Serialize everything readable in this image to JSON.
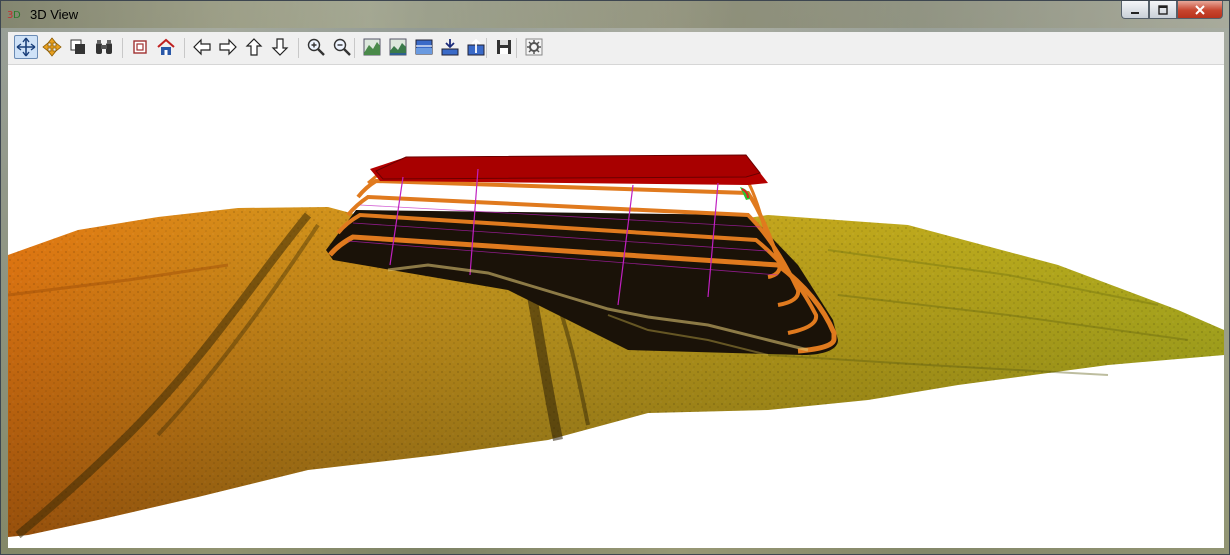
{
  "window": {
    "title": "3D View",
    "icon": "3d-view-app-icon"
  },
  "window_buttons": {
    "minimize": "minimize-icon",
    "maximize": "maximize-icon",
    "close": "close-icon"
  },
  "toolbar": {
    "buttons": [
      {
        "name": "rotate-tool",
        "icon": "rotate-arrows-icon"
      },
      {
        "name": "pan-tool",
        "icon": "pan-move-icon"
      },
      {
        "name": "layers-tool",
        "icon": "layers-icon"
      },
      {
        "name": "binoculars-tool",
        "icon": "binoculars-icon"
      },
      {
        "name": "fit-extent-tool",
        "icon": "fit-extent-icon"
      },
      {
        "name": "home-view-tool",
        "icon": "home-icon"
      },
      {
        "name": "move-left-tool",
        "icon": "arrow-left-icon"
      },
      {
        "name": "move-right-tool",
        "icon": "arrow-right-icon"
      },
      {
        "name": "move-up-tool",
        "icon": "arrow-up-icon"
      },
      {
        "name": "move-down-tool",
        "icon": "arrow-down-icon"
      },
      {
        "name": "zoom-in-tool",
        "icon": "zoom-in-icon"
      },
      {
        "name": "zoom-out-tool",
        "icon": "zoom-out-icon"
      },
      {
        "name": "terrain-tool-1",
        "icon": "terrain-icon"
      },
      {
        "name": "terrain-tool-2",
        "icon": "terrain-icon"
      },
      {
        "name": "water-level-tool",
        "icon": "water-level-icon"
      },
      {
        "name": "lower-level-tool",
        "icon": "lower-level-icon"
      },
      {
        "name": "raise-level-tool",
        "icon": "raise-level-icon"
      },
      {
        "name": "save-tool",
        "icon": "save-icon"
      },
      {
        "name": "settings-tool",
        "icon": "settings-icon"
      }
    ]
  },
  "colors": {
    "surface_high": "#e87a12",
    "surface_mid": "#c9a020",
    "surface_low": "#b9b820",
    "structure_top": "#b30000",
    "structure_band": "#1a1208",
    "structure_edge": "#e07a1e",
    "grid_lines": "#c020c0"
  }
}
